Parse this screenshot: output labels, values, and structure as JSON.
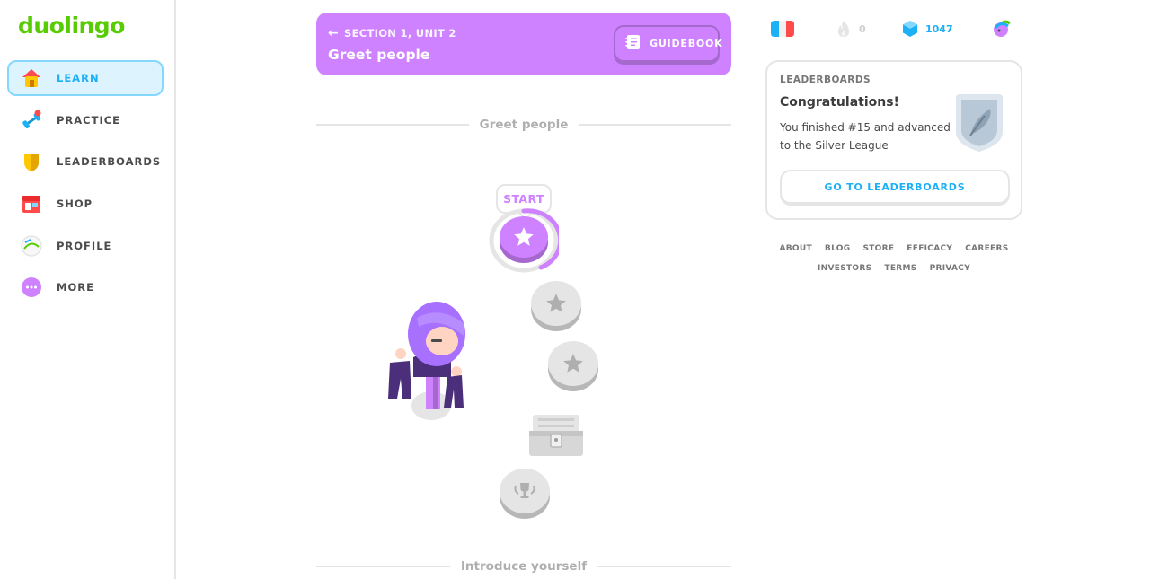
{
  "app": {
    "logo": "duolingo"
  },
  "sidebar": {
    "items": [
      {
        "label": "LEARN",
        "icon": "home-icon",
        "active": true
      },
      {
        "label": "PRACTICE",
        "icon": "dumbbell-icon"
      },
      {
        "label": "LEADERBOARDS",
        "icon": "shield-icon"
      },
      {
        "label": "SHOP",
        "icon": "shop-icon"
      },
      {
        "label": "PROFILE",
        "icon": "avatar-icon"
      },
      {
        "label": "MORE",
        "icon": "more-icon"
      }
    ]
  },
  "unit": {
    "section_label": "SECTION 1, UNIT 2",
    "title": "Greet people",
    "guidebook_label": "GUIDEBOOK",
    "color": "#ce82ff"
  },
  "path": {
    "section_heading": "Greet people",
    "start_label": "START",
    "next_heading": "Introduce yourself"
  },
  "stats": {
    "language": "french-flag-icon",
    "streak": "0",
    "gems": "1047"
  },
  "leaderboard_card": {
    "heading": "LEADERBOARDS",
    "title": "Congratulations!",
    "body": "You finished #15 and advanced to the Silver League",
    "button_label": "GO TO LEADERBOARDS"
  },
  "footer": {
    "row1": [
      "ABOUT",
      "BLOG",
      "STORE",
      "EFFICACY",
      "CAREERS"
    ],
    "row2": [
      "INVESTORS",
      "TERMS",
      "PRIVACY"
    ]
  },
  "colors": {
    "brand": "#58cc02",
    "accent": "#1cb0f6",
    "unit": "#ce82ff",
    "locked": "#e5e5e5"
  }
}
